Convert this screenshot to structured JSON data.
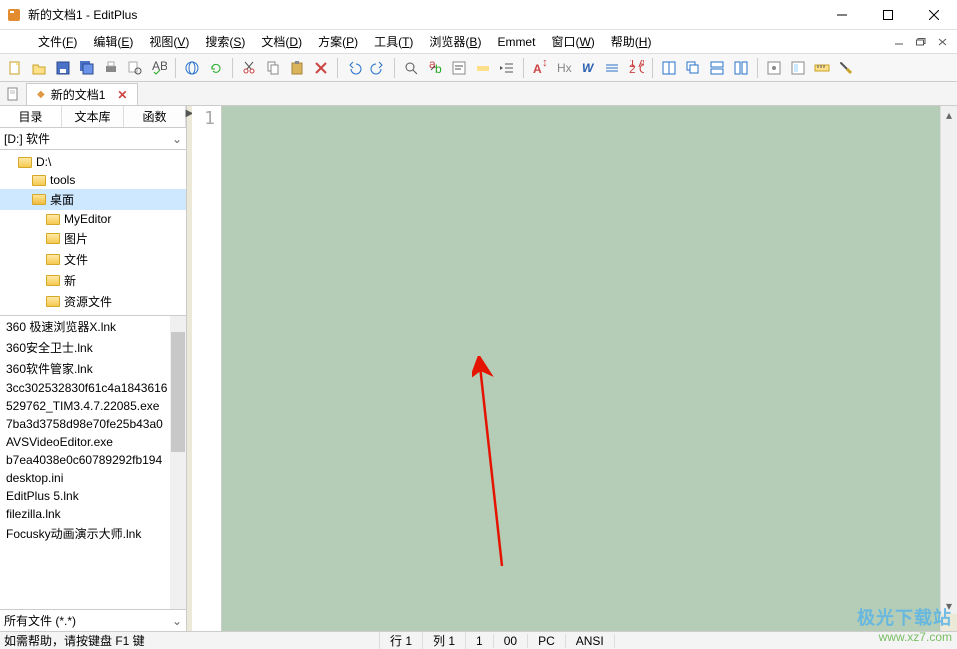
{
  "window": {
    "title": "新的文档1 - EditPlus"
  },
  "menus": [
    {
      "label": "文件",
      "key": "F"
    },
    {
      "label": "编辑",
      "key": "E"
    },
    {
      "label": "视图",
      "key": "V"
    },
    {
      "label": "搜索",
      "key": "S"
    },
    {
      "label": "文档",
      "key": "D"
    },
    {
      "label": "方案",
      "key": "P"
    },
    {
      "label": "工具",
      "key": "T"
    },
    {
      "label": "浏览器",
      "key": "B"
    },
    {
      "label": "Emmet",
      "key": ""
    },
    {
      "label": "窗口",
      "key": "W"
    },
    {
      "label": "帮助",
      "key": "H"
    }
  ],
  "toolbar_icons": [
    "new-file",
    "open-file",
    "save",
    "save-all",
    "print",
    "print-preview",
    "spell-check",
    "sep",
    "browser",
    "reload",
    "sep",
    "cut",
    "copy",
    "paste",
    "delete",
    "sep",
    "undo",
    "redo",
    "sep",
    "find",
    "replace",
    "word-wrap",
    "highlight",
    "indent",
    "sep",
    "font-larger",
    "hex",
    "word",
    "whitespace",
    "columns",
    "sep",
    "window-split",
    "window-cascade",
    "window-tile-h",
    "window-tile-v",
    "sep",
    "tools",
    "columns-sel",
    "ruler",
    "settings"
  ],
  "tab": {
    "name": "新的文档1"
  },
  "sidebar": {
    "tabs": [
      "目录",
      "文本库",
      "函数"
    ],
    "drive": "[D:] 软件",
    "tree": [
      {
        "name": "D:\\",
        "depth": 0,
        "sel": false
      },
      {
        "name": "tools",
        "depth": 1,
        "sel": false
      },
      {
        "name": "桌面",
        "depth": 1,
        "sel": true
      },
      {
        "name": "MyEditor",
        "depth": 2,
        "sel": false
      },
      {
        "name": "图片",
        "depth": 2,
        "sel": false
      },
      {
        "name": "文件",
        "depth": 2,
        "sel": false
      },
      {
        "name": "新",
        "depth": 2,
        "sel": false
      },
      {
        "name": "资源文件",
        "depth": 2,
        "sel": false
      }
    ],
    "files": [
      "360 极速浏览器X.lnk",
      "360安全卫士.lnk",
      "360软件管家.lnk",
      "3cc302532830f61c4a1843616",
      "529762_TIM3.4.7.22085.exe",
      "7ba3d3758d98e70fe25b43a0",
      "AVSVideoEditor.exe",
      "b7ea4038e0c60789292fb194",
      "desktop.ini",
      "EditPlus 5.lnk",
      "filezilla.lnk",
      "Focusky动画演示大师.lnk"
    ],
    "filter": "所有文件 (*.*)"
  },
  "editor": {
    "line_no": "1"
  },
  "status": {
    "help": "如需帮助，请按键盘 F1 键",
    "line": "行 1",
    "col": "列 1",
    "lines": "1",
    "mode": "00",
    "pc": "PC",
    "enc": "ANSI"
  },
  "watermark": {
    "brand": "极光下载站",
    "url": "www.xz7.com"
  }
}
